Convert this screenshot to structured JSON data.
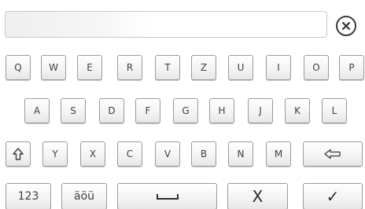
{
  "input": {
    "value": "",
    "placeholder": ""
  },
  "keyboard": {
    "row1": [
      "Q",
      "W",
      "E",
      "R",
      "T",
      "Z",
      "U",
      "I",
      "O",
      "P"
    ],
    "row2": [
      "A",
      "S",
      "D",
      "F",
      "G",
      "H",
      "J",
      "K",
      "L"
    ],
    "row3": [
      "Y",
      "X",
      "C",
      "V",
      "B",
      "N",
      "M"
    ],
    "numbers_label": "123",
    "umlaut_label": "äöü",
    "cancel_label": "X",
    "confirm_label": "✓"
  },
  "icons": {
    "clear": "clear-circle-x-icon",
    "shift": "shift-arrow-up-icon",
    "backspace": "backspace-arrow-left-icon",
    "space": "space-bar-icon"
  },
  "colors": {
    "key_border": "#9a9a9a",
    "key_text": "#404040",
    "background": "#ffffff"
  }
}
